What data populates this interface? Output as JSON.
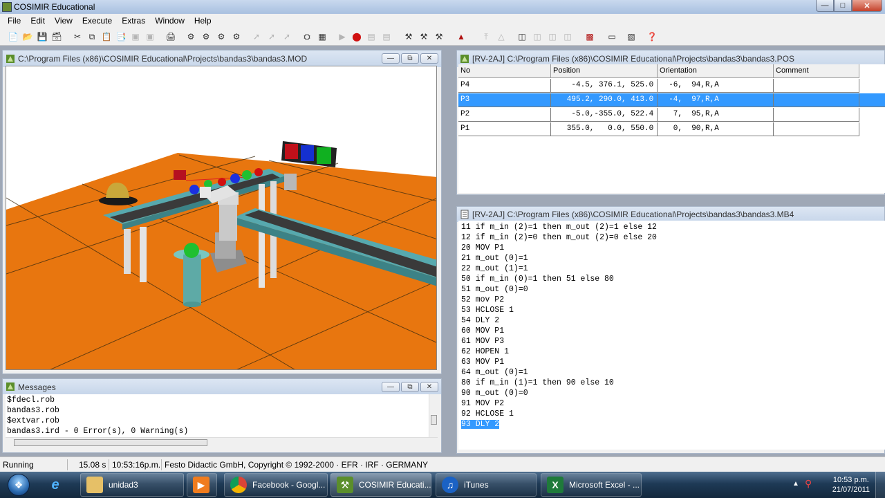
{
  "app": {
    "title": "COSIMIR Educational"
  },
  "menu": [
    "File",
    "Edit",
    "View",
    "Execute",
    "Extras",
    "Window",
    "Help"
  ],
  "toolbar_icons": [
    "new-file",
    "open-folder",
    "save",
    "save-all",
    "cut",
    "copy",
    "paste",
    "paste-special",
    "disabled-a",
    "disabled-b",
    "print",
    "robot-a",
    "robot-b",
    "robot-c",
    "robot-d",
    "disabled-c",
    "disabled-d",
    "disabled-e",
    "settings",
    "grid",
    "step",
    "stop",
    "disabled-f",
    "disabled-g",
    "arm-a",
    "arm-b",
    "arm-c",
    "teach",
    "disabled-h",
    "disabled-i",
    "io-a",
    "io-b",
    "io-c",
    "io-d",
    "io-e",
    "window-a",
    "window-b",
    "help-context"
  ],
  "viewport": {
    "title": "C:\\Program Files (x86)\\COSIMIR Educational\\Projects\\bandas3\\bandas3.MOD"
  },
  "positions": {
    "title": "[RV-2AJ]  C:\\Program Files (x86)\\COSIMIR Educational\\Projects\\bandas3\\bandas3.POS",
    "headers": [
      "No",
      "Position",
      "Orientation",
      "Comment"
    ],
    "rows": [
      {
        "no": "P4",
        "position": "    -4.5, 376.1, 525.0",
        "orientation": "  -6,  94,R,A",
        "comment": ""
      },
      {
        "no": "P3",
        "position": "   495.2, 290.0, 413.0",
        "orientation": "  -4,  97,R,A",
        "comment": ""
      },
      {
        "no": "P2",
        "position": "    -5.0,-355.0, 522.4",
        "orientation": "   7,  95,R,A",
        "comment": ""
      },
      {
        "no": "P1",
        "position": "   355.0,   0.0, 550.0",
        "orientation": "   0,  90,R,A",
        "comment": ""
      }
    ],
    "selected_row": 1
  },
  "program": {
    "title": "[RV-2AJ]  C:\\Program Files (x86)\\COSIMIR Educational\\Projects\\bandas3\\bandas3.MB4",
    "lines": [
      "11 if m_in (2)=1 then m_out (2)=1 else 12",
      "12 if m_in (2)=0 then m_out (2)=0 else 20",
      "20 MOV P1",
      "21 m_out (0)=1",
      "22 m_out (1)=1",
      "50 if m_in (0)=1 then 51 else 80",
      "51 m_out (0)=0",
      "52 mov P2",
      "53 HCLOSE 1",
      "54 DLY 2",
      "60 MOV P1",
      "61 MOV P3",
      "62 HOPEN 1",
      "63 MOV P1",
      "64 m_out (0)=1",
      "80 if m_in (1)=1 then 90 else 10",
      "90 m_out (0)=0",
      "91 MOV P2",
      "92 HCLOSE 1",
      "93 DLY 2"
    ],
    "selected_line": 19
  },
  "messages": {
    "title": "Messages",
    "lines": [
      "$fdecl.rob",
      "bandas3.rob",
      "$extvar.rob",
      "bandas3.ird - 0 Error(s), 0 Warning(s)"
    ]
  },
  "status": {
    "state": "Running",
    "elapsed": "15.08 s",
    "time": "10:53:16p.m.",
    "copyright": "Festo Didactic GmbH, Copyright © 1992-2000 · EFR · IRF · GERMANY"
  },
  "taskbar": {
    "buttons": [
      {
        "label": "unidad3",
        "icon": "folder-icon"
      },
      {
        "label": "",
        "icon": "media-player-icon"
      },
      {
        "label": "Facebook - Googl...",
        "icon": "chrome-icon"
      },
      {
        "label": "COSIMIR Educati...",
        "icon": "cosimir-icon"
      },
      {
        "label": "iTunes",
        "icon": "itunes-icon"
      },
      {
        "label": "Microsoft Excel - ...",
        "icon": "excel-icon"
      }
    ],
    "clock_time": "10:53 p.m.",
    "clock_date": "21/07/2011"
  },
  "colors": {
    "floor": "#e8760f",
    "selection": "#3399ff",
    "conveyor": "#4f9aa0"
  }
}
